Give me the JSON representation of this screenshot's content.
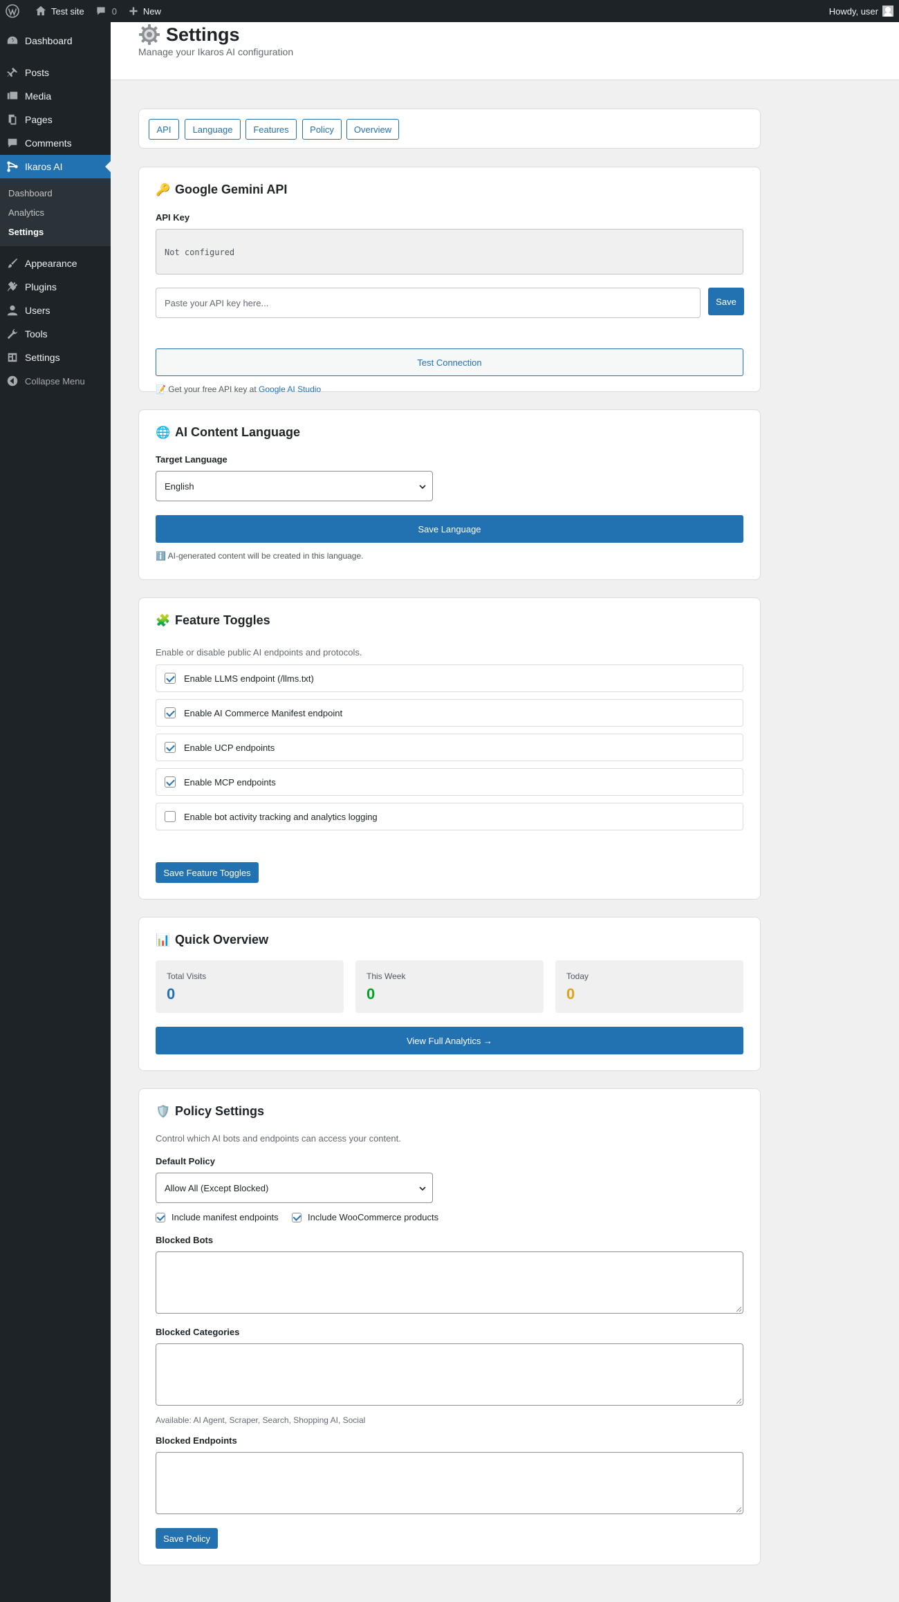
{
  "adminbar": {
    "site_name": "Test site",
    "comments_count": "0",
    "new_label": "New",
    "howdy": "Howdy, user"
  },
  "sidebar": {
    "items_top": [
      {
        "label": "Dashboard",
        "icon": "dashboard-icon"
      },
      {
        "label": "Posts",
        "icon": "pin-icon"
      },
      {
        "label": "Media",
        "icon": "media-icon"
      },
      {
        "label": "Pages",
        "icon": "pages-icon"
      },
      {
        "label": "Comments",
        "icon": "comment-icon"
      },
      {
        "label": "Ikaros AI",
        "icon": "ikaros-icon"
      }
    ],
    "submenu": [
      {
        "label": "Dashboard"
      },
      {
        "label": "Analytics"
      },
      {
        "label": "Settings"
      }
    ],
    "items_bottom": [
      {
        "label": "Appearance",
        "icon": "brush-icon"
      },
      {
        "label": "Plugins",
        "icon": "plugin-icon"
      },
      {
        "label": "Users",
        "icon": "users-icon"
      },
      {
        "label": "Tools",
        "icon": "wrench-icon"
      },
      {
        "label": "Settings",
        "icon": "settings-icon"
      }
    ],
    "collapse_label": "Collapse Menu"
  },
  "header": {
    "title": "Settings",
    "subtitle": "Manage your Ikaros AI configuration"
  },
  "tabs": [
    "API",
    "Language",
    "Features",
    "Policy",
    "Overview"
  ],
  "api": {
    "title": "Google Gemini API",
    "key_label": "API Key",
    "key_status": "Not configured",
    "input_placeholder": "Paste your API key here...",
    "save_label": "Save",
    "test_label": "Test Connection",
    "note_prefix": "Get your free API key at",
    "note_link": "Google AI Studio"
  },
  "language": {
    "title": "AI Content Language",
    "target_label": "Target Language",
    "selected": "English",
    "save_label": "Save Language",
    "note": "AI-generated content will be created in this language."
  },
  "features": {
    "title": "Feature Toggles",
    "description": "Enable or disable public AI endpoints and protocols.",
    "toggles": [
      {
        "label": "Enable LLMS endpoint (/llms.txt)",
        "checked": true
      },
      {
        "label": "Enable AI Commerce Manifest endpoint",
        "checked": true
      },
      {
        "label": "Enable UCP endpoints",
        "checked": true
      },
      {
        "label": "Enable MCP endpoints",
        "checked": true
      },
      {
        "label": "Enable bot activity tracking and analytics logging",
        "checked": false
      }
    ],
    "save_label": "Save Feature Toggles"
  },
  "overview": {
    "title": "Quick Overview",
    "stats": [
      {
        "label": "Total Visits",
        "value": "0",
        "color": "#2271b1"
      },
      {
        "label": "This Week",
        "value": "0",
        "color": "#00a32a"
      },
      {
        "label": "Today",
        "value": "0",
        "color": "#dba617"
      }
    ],
    "button_label": "View Full Analytics →"
  },
  "policy": {
    "title": "Policy Settings",
    "description": "Control which AI bots and endpoints can access your content.",
    "default_label": "Default Policy",
    "default_selected": "Allow All (Except Blocked)",
    "include_manifest": "Include manifest endpoints",
    "include_woo": "Include WooCommerce products",
    "blocked_bots_label": "Blocked Bots",
    "blocked_categories_label": "Blocked Categories",
    "categories_hint": "Available: AI Agent, Scraper, Search, Shopping AI, Social",
    "blocked_endpoints_label": "Blocked Endpoints",
    "save_label": "Save Policy"
  },
  "colors": {
    "accent": "#2271b1",
    "sidebar_bg": "#1d2327",
    "admin_bar_bg": "#1d2327"
  }
}
